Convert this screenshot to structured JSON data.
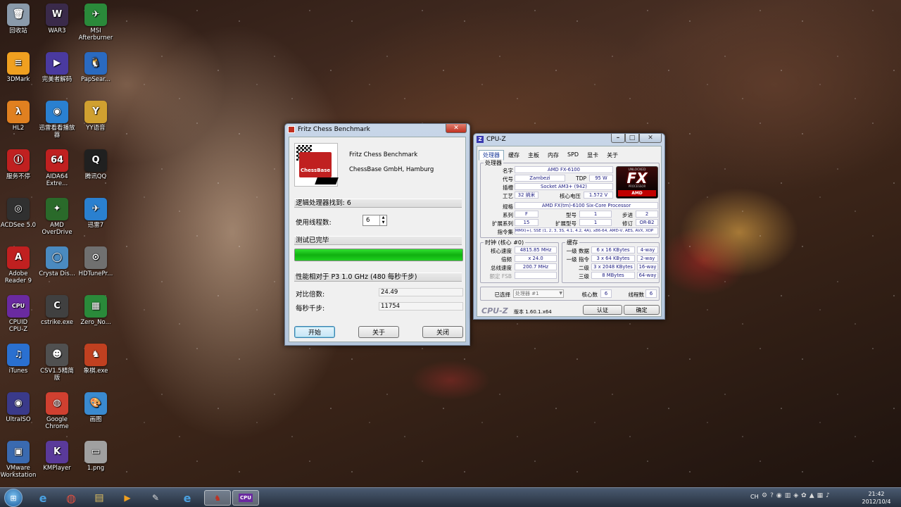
{
  "desktop_icons": [
    {
      "label": "回收站",
      "color": "#8a9aaa",
      "glyph": "🗑"
    },
    {
      "label": "WAR3",
      "color": "#3a2a4a",
      "glyph": "W"
    },
    {
      "label": "MSI\nAfterburner",
      "color": "#2a8a3a",
      "glyph": "✈"
    },
    {
      "label": "3DMark",
      "color": "#f0a020",
      "glyph": "≡"
    },
    {
      "label": "完美者解码",
      "color": "#4a3aa0",
      "glyph": "▶"
    },
    {
      "label": "PapSear...",
      "color": "#2a6ac0",
      "glyph": "🐧"
    },
    {
      "label": "HL2",
      "color": "#e08020",
      "glyph": "λ"
    },
    {
      "label": "迅雷看看播放\n器",
      "color": "#2a80d0",
      "glyph": "◉"
    },
    {
      "label": "YY语音",
      "color": "#d0a030",
      "glyph": "Y"
    },
    {
      "label": "服务不停",
      "color": "#c02020",
      "glyph": "Ⓘ"
    },
    {
      "label": "AIDA64\nExtre...",
      "color": "#c02020",
      "glyph": "64"
    },
    {
      "label": "腾讯QQ",
      "color": "#202020",
      "glyph": "Q"
    },
    {
      "label": "ACDSee 5.0",
      "color": "#303030",
      "glyph": "◎"
    },
    {
      "label": "AMD\nOverDrive",
      "color": "#2a6a2a",
      "glyph": "✦"
    },
    {
      "label": "迅雷7",
      "color": "#2a80d0",
      "glyph": "✈"
    },
    {
      "label": "Adobe\nReader 9",
      "color": "#c02020",
      "glyph": "A"
    },
    {
      "label": "Crysta Dis...",
      "color": "#4a8ac0",
      "glyph": "◯"
    },
    {
      "label": "HDTunePr...",
      "color": "#707070",
      "glyph": "⊙"
    },
    {
      "label": "CPUID\nCPU-Z",
      "color": "#6a2aa0",
      "glyph": "CPU"
    },
    {
      "label": "cstrike.exe",
      "color": "#404040",
      "glyph": "C"
    },
    {
      "label": "Zero_No...",
      "color": "#2a8a3a",
      "glyph": "▦"
    },
    {
      "label": "iTunes",
      "color": "#2a70d0",
      "glyph": "♫"
    },
    {
      "label": "CSV1.5精简\n版",
      "color": "#505050",
      "glyph": "☻"
    },
    {
      "label": "象棋.exe",
      "color": "#c04020",
      "glyph": "♞"
    },
    {
      "label": "UltraISO",
      "color": "#3a3a8a",
      "glyph": "◉"
    },
    {
      "label": "Google\nChrome",
      "color": "#d04030",
      "glyph": "◍"
    },
    {
      "label": "画图",
      "color": "#3a8ad0",
      "glyph": "🎨"
    },
    {
      "label": "VMware\nWorkstation",
      "color": "#3a6ab0",
      "glyph": "▣"
    },
    {
      "label": "KMPlayer",
      "color": "#5a3a9a",
      "glyph": "K"
    },
    {
      "label": "1.png",
      "color": "#a0a0a0",
      "glyph": "▭"
    }
  ],
  "fritz": {
    "title": "Fritz Chess Benchmark",
    "logo_text": "ChessBase",
    "product": "Fritz Chess Benchmark",
    "company": "ChessBase GmbH, Hamburg",
    "processors_found": "逻辑处理器找到: 6",
    "threads_label": "使用线程数:",
    "threads_value": "6",
    "status": "测试已完毕",
    "progress_fraction": 1.0,
    "perf_header": "性能相对于 P3 1.0 GHz (480 每秒千步)",
    "ratio_label": "对比倍数:",
    "ratio_value": "24.49",
    "kns_label": "每秒千步:",
    "kns_value": "11754",
    "btn_start": "开始",
    "btn_about": "关于",
    "btn_close": "关闭"
  },
  "cpuz": {
    "title": "CPU-Z",
    "tabs": [
      "处理器",
      "缓存",
      "主板",
      "内存",
      "SPD",
      "显卡",
      "关于"
    ],
    "proc_group": "处理器",
    "name_label": "名字",
    "name": "AMD FX-6100",
    "code_label": "代号",
    "code": "Zambezi",
    "tdp_label": "TDP",
    "tdp": "95 W",
    "pkg_label": "插槽",
    "pkg": "Socket AM3+ (942)",
    "tech_label": "工艺",
    "tech": "32 纳米",
    "volt_label": "核心电压",
    "volt": "1.572 V",
    "spec_label": "规格",
    "spec": "AMD FX(tm)-6100 Six-Core Processor",
    "family_label": "系列",
    "family": "F",
    "model_label": "型号",
    "model": "1",
    "step_label": "步进",
    "step": "2",
    "extfam_label": "扩展系列",
    "extfam": "15",
    "extmod_label": "扩展型号",
    "extmod": "1",
    "rev_label": "修订",
    "rev": "OR-B2",
    "inst_label": "指令集",
    "inst": "MMX(+), SSE (1, 2, 3, 3S, 4.1, 4.2, 4A), x86-64, AMD-V, AES, AVX, XOP",
    "logo_unlocked": "UNLOCKED",
    "logo_fx": "FX",
    "logo_processor": "PROCESSOR",
    "logo_amd": "AMD",
    "clock_group": "时钟 (核心 #0)",
    "core_speed_label": "核心速度",
    "core_speed": "4815.85 MHz",
    "mult_label": "倍频",
    "mult": "x 24.0",
    "bus_label": "总线速度",
    "bus": "200.7 MHz",
    "fsb_label": "额定 FSB",
    "fsb": "",
    "cache_group": "缓存",
    "l1d_label": "一级 数据",
    "l1d": "6 x 16 KBytes",
    "l1d_way": "4-way",
    "l1i_label": "一级 指令",
    "l1i": "3 x 64 KBytes",
    "l1i_way": "2-way",
    "l2_label": "二级",
    "l2": "3 x 2048 KBytes",
    "l2_way": "16-way",
    "l3_label": "三级",
    "l3": "8 MBytes",
    "l3_way": "64-way",
    "sel_label": "已选择",
    "sel": "处理器 #1",
    "cores_label": "核心数",
    "cores": "6",
    "threads_label": "线程数",
    "threads": "6",
    "brand": "CPU-Z",
    "version": "版本 1.60.1.x64",
    "btn_validate": "认证",
    "btn_ok": "确定"
  },
  "taskbar": {
    "tray_lang": "CH",
    "time": "21:42",
    "date": "2012/10/4"
  }
}
